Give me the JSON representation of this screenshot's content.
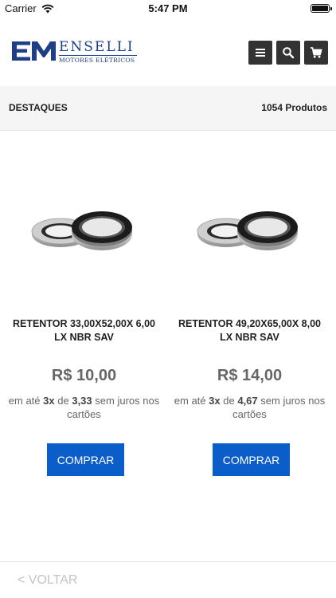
{
  "status_bar": {
    "carrier": "Carrier",
    "time": "5:47 PM"
  },
  "header": {
    "logo": {
      "mark": "EM",
      "name": "ENSELLI",
      "subtitle": "MOTORES ELÉTRICOS"
    },
    "menu_icon": "hamburger-icon",
    "search_icon": "search-icon",
    "cart_icon": "cart-icon",
    "button_color": "#333333",
    "brand_color": "#1e3e85"
  },
  "section": {
    "title": "DESTAQUES",
    "count": "1054 Produtos"
  },
  "products": [
    {
      "name": "RETENTOR 33,00X52,00X 6,00 LX NBR SAV",
      "price": "R$ 10,00",
      "installments": {
        "prefix": "em até",
        "times": "3x",
        "mid": "de",
        "amount": "3,33",
        "suffix": "sem juros nos cartões"
      },
      "buy_label": "COMPRAR"
    },
    {
      "name": "RETENTOR 49,20X65,00X 8,00 LX NBR SAV",
      "price": "R$ 14,00",
      "installments": {
        "prefix": "em até",
        "times": "3x",
        "mid": "de",
        "amount": "4,67",
        "suffix": "sem juros nos cartões"
      },
      "buy_label": "COMPRAR"
    }
  ],
  "footer": {
    "back_label": "< VOLTAR"
  },
  "colors": {
    "buy_button": "#0b5ec9",
    "section_bg": "#f5f5f5"
  }
}
